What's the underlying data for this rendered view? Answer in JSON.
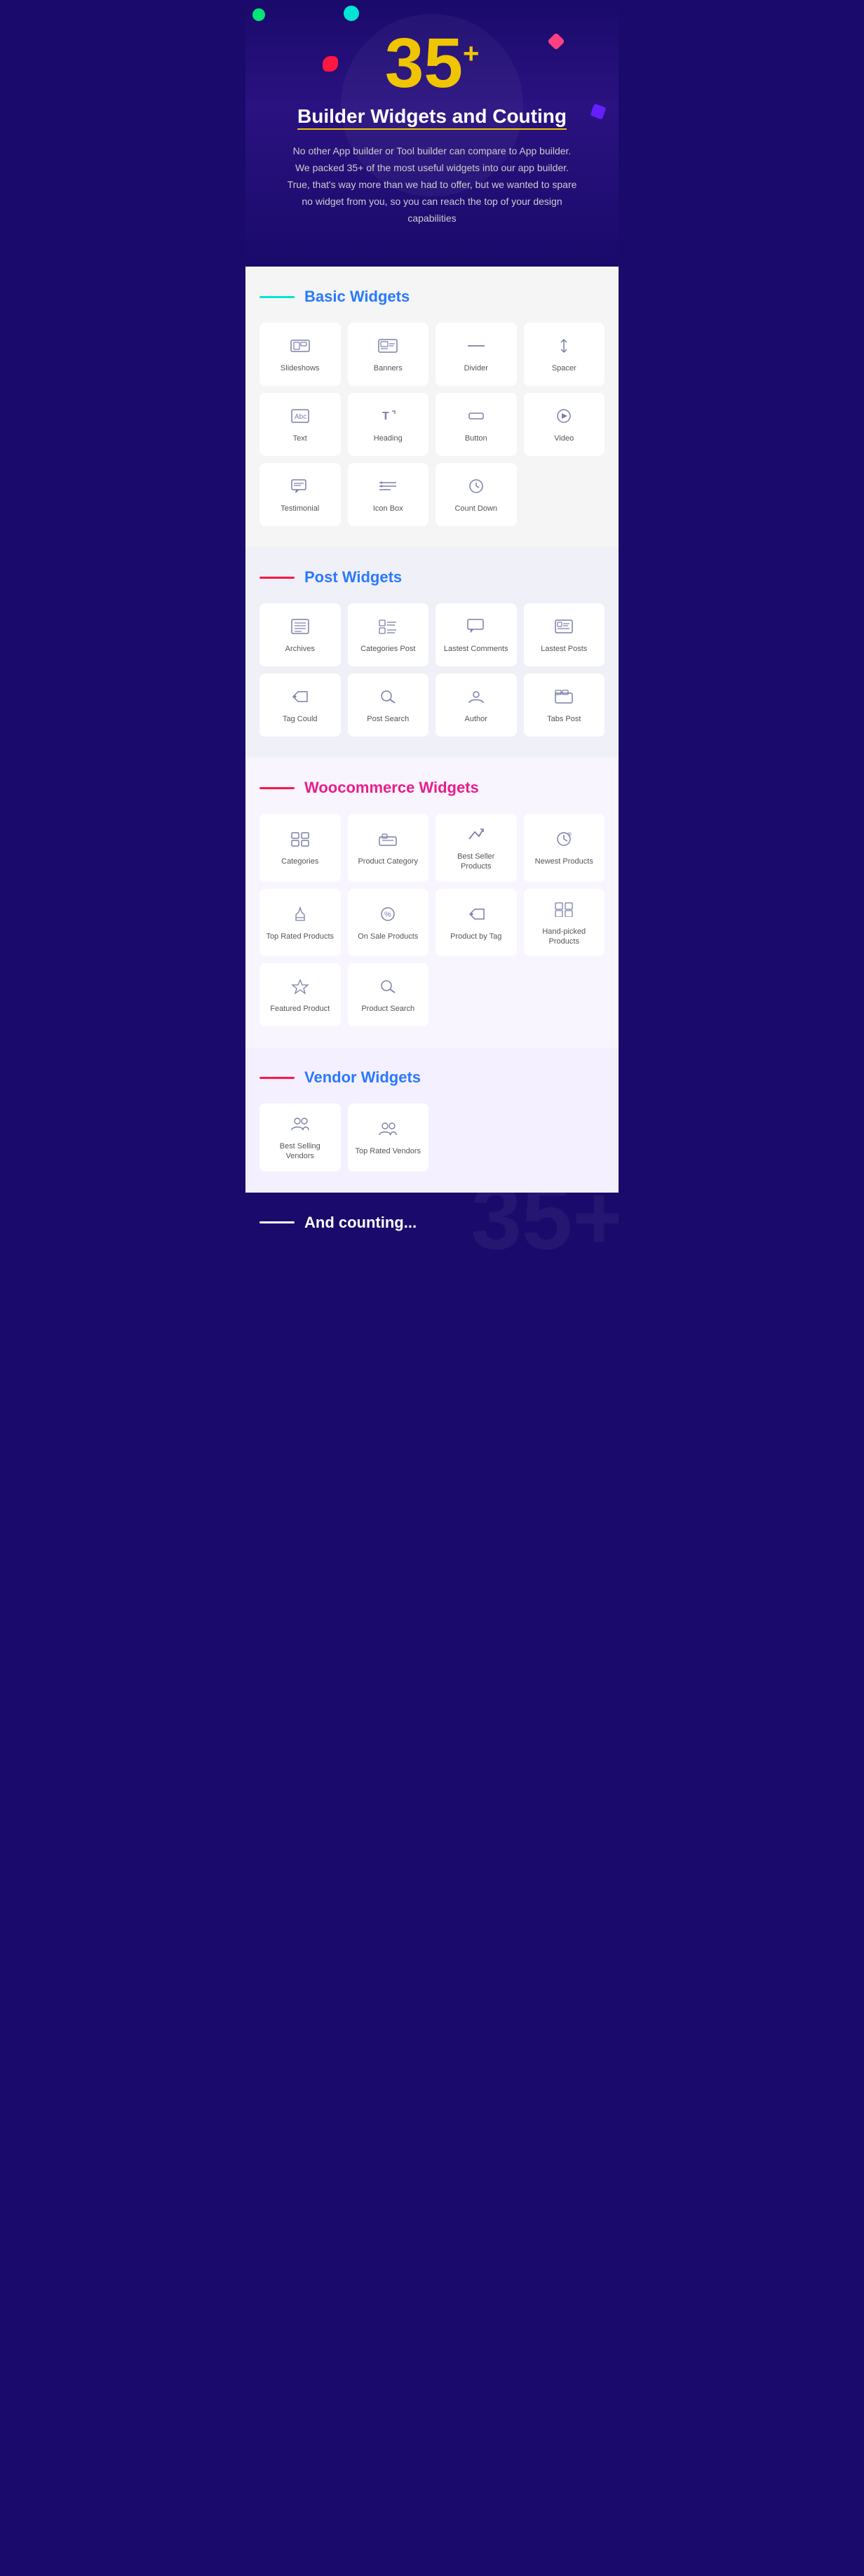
{
  "hero": {
    "number": "35",
    "plus": "+",
    "title_part1": "Builder Widgets",
    "title_part2": " and Couting",
    "description": "No other App builder or Tool builder can compare to App builder. We packed 35+ of the most useful widgets into our app builder. True, that's way more than we had to offer, but we wanted to spare no widget from you, so you can reach the top of your design capabilities"
  },
  "sections": {
    "basic": {
      "label": "Basic Widgets",
      "line_color": "#00e5d4",
      "title_color": "#2979ff",
      "widgets_row1": [
        {
          "id": "slideshows",
          "label": "Slideshows",
          "icon": "⊞"
        },
        {
          "id": "banners",
          "label": "Banners",
          "icon": "🖼"
        },
        {
          "id": "divider",
          "label": "Divider",
          "icon": "—"
        },
        {
          "id": "spacer",
          "label": "Spacer",
          "icon": "↕"
        }
      ],
      "widgets_row2": [
        {
          "id": "text",
          "label": "Text",
          "icon": "Abc"
        },
        {
          "id": "heading",
          "label": "Heading",
          "icon": "T↑"
        },
        {
          "id": "button",
          "label": "Button",
          "icon": "▭"
        },
        {
          "id": "video",
          "label": "Video",
          "icon": "▷"
        }
      ],
      "widgets_row3": [
        {
          "id": "testimonial",
          "label": "Testimonial",
          "icon": "💬"
        },
        {
          "id": "icon-box",
          "label": "Icon Box",
          "icon": "☰"
        },
        {
          "id": "count-down",
          "label": "Count Down",
          "icon": "⏱"
        }
      ]
    },
    "post": {
      "label": "Post Widgets",
      "line_color": "#ff1744",
      "title_color": "#2979ff",
      "widgets_row1": [
        {
          "id": "archives",
          "label": "Archives",
          "icon": "📅"
        },
        {
          "id": "categories-post",
          "label": "Categories Post",
          "icon": "☰"
        },
        {
          "id": "lastest-comments",
          "label": "Lastest Comments",
          "icon": "💬"
        },
        {
          "id": "lastest-posts",
          "label": "Lastest Posts",
          "icon": "📄"
        }
      ],
      "widgets_row2": [
        {
          "id": "tag-could",
          "label": "Tag Could",
          "icon": "🏷"
        },
        {
          "id": "post-search",
          "label": "Post Search",
          "icon": "🔍"
        },
        {
          "id": "author",
          "label": "Author",
          "icon": "👤"
        },
        {
          "id": "tabs-post",
          "label": "Tabs Post",
          "icon": "📊"
        }
      ]
    },
    "woo": {
      "label": "Woocommerce Widgets",
      "line_color": "#ff1744",
      "title_color": "#e91e8c",
      "widgets_row1": [
        {
          "id": "categories",
          "label": "Categories",
          "icon": "🗂"
        },
        {
          "id": "product-category",
          "label": "Product Category",
          "icon": "📊"
        },
        {
          "id": "best-seller-products",
          "label": "Best Seller Products",
          "icon": "↗"
        },
        {
          "id": "newest-products",
          "label": "Newest Products",
          "icon": "⚙"
        }
      ],
      "widgets_row2": [
        {
          "id": "top-rated-products",
          "label": "Top Rated Products",
          "icon": "👍"
        },
        {
          "id": "on-sale-products",
          "label": "On Sale Products",
          "icon": "%"
        },
        {
          "id": "product-by-tag",
          "label": "Product by Tag",
          "icon": "🏷"
        },
        {
          "id": "hand-picked-products",
          "label": "Hand-picked Products",
          "icon": "⊞"
        }
      ],
      "widgets_row3": [
        {
          "id": "featured-product",
          "label": "Featured Product",
          "icon": "☆"
        },
        {
          "id": "product-search",
          "label": "Product Search",
          "icon": "🔍"
        }
      ]
    },
    "vendor": {
      "label": "Vendor Widgets",
      "line_color": "#ff1744",
      "title_color": "#2979ff",
      "widgets_row1": [
        {
          "id": "best-selling-vendors",
          "label": "Best Selling Vendors",
          "icon": "👥"
        },
        {
          "id": "top-rated-vendors",
          "label": "Top Rated Vendors",
          "icon": "👥"
        }
      ]
    }
  },
  "ending": {
    "label": "And counting...",
    "watermark": "35+"
  }
}
